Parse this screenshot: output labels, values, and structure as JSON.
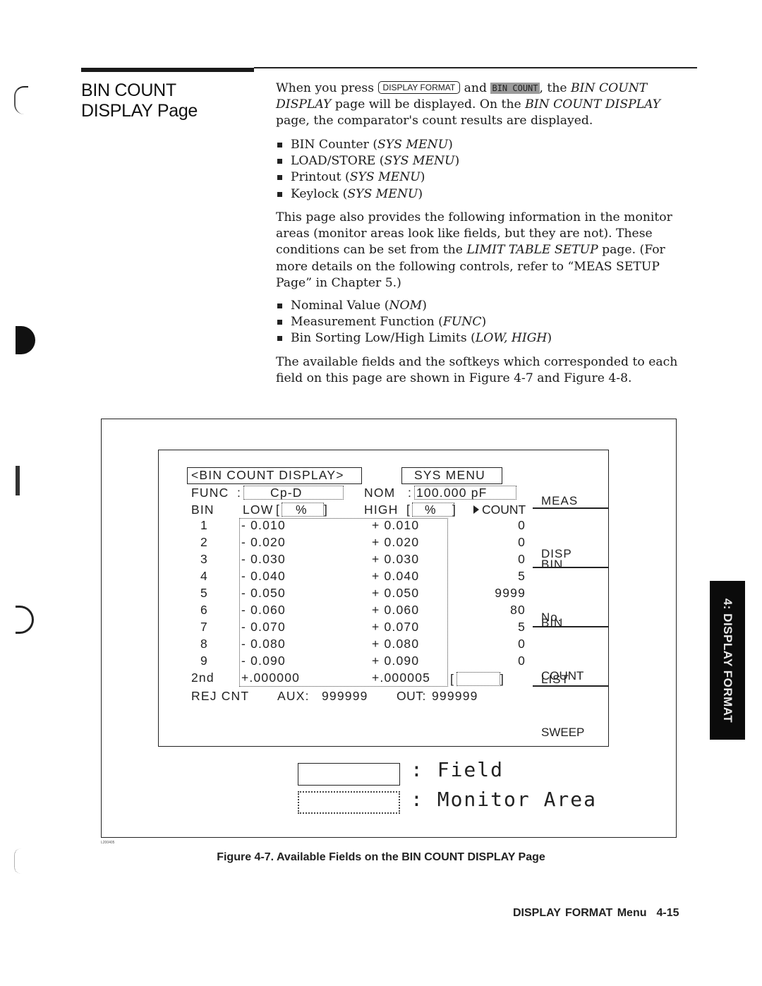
{
  "section": {
    "title_line1": "BIN COUNT",
    "title_line2": "DISPLAY Page"
  },
  "intro": {
    "text_before_key": "When you press ",
    "hardkey": "DISPLAY FORMAT",
    "text_and": " and ",
    "softkey": "BIN COUNT",
    "text_the": ", the ",
    "page_name_1": "BIN COUNT DISPLAY",
    "text_mid": " page will be displayed. On the ",
    "page_name_2": "BIN COUNT DISPLAY",
    "text_end": " page, the comparator's count results are displayed."
  },
  "bullets_fields": [
    {
      "label": "BIN Counter",
      "menu": "SYS MENU"
    },
    {
      "label": "LOAD/STORE",
      "menu": "SYS MENU"
    },
    {
      "label": "Printout",
      "menu": "SYS MENU"
    },
    {
      "label": "Keylock",
      "menu": "SYS MENU"
    }
  ],
  "para2": {
    "text_a": "This page also provides the following information in the monitor areas (monitor areas look like fields, but they are not). These conditions can be set from the ",
    "page_ref": "LIMIT TABLE SETUP",
    "text_b": " page. (For more details on the following controls, refer to “MEAS SETUP Page” in Chapter 5.)"
  },
  "bullets_monitors": [
    {
      "label": "Nominal Value",
      "abbr": "NOM"
    },
    {
      "label": "Measurement Function",
      "abbr": "FUNC"
    },
    {
      "label": "Bin Sorting Low/High Limits",
      "abbr": "LOW, HIGH"
    }
  ],
  "para3": "The available fields and the softkeys which corresponded to each field on this page are shown in Figure 4-7 and Figure 4-8.",
  "lcd": {
    "page_field": "<BIN COUNT DISPLAY>",
    "sys_menu_field": "SYS MENU",
    "func_label": "FUNC",
    "func_value": "Cp-D",
    "nom_label": "NOM",
    "nom_value": "100.000 pF",
    "bin_header": "BIN",
    "low_header": "LOW",
    "high_header": "HIGH",
    "unit": "%",
    "count_header": "COUNT",
    "rows": [
      {
        "bin": "1",
        "low": "- 0.010",
        "high": "+ 0.010",
        "count": "0"
      },
      {
        "bin": "2",
        "low": "- 0.020",
        "high": "+ 0.020",
        "count": "0"
      },
      {
        "bin": "3",
        "low": "- 0.030",
        "high": "+ 0.030",
        "count": "0"
      },
      {
        "bin": "4",
        "low": "- 0.040",
        "high": "+ 0.040",
        "count": "5"
      },
      {
        "bin": "5",
        "low": "- 0.050",
        "high": "+ 0.050",
        "count": "9999"
      },
      {
        "bin": "6",
        "low": "- 0.060",
        "high": "+ 0.060",
        "count": "80"
      },
      {
        "bin": "7",
        "low": "- 0.070",
        "high": "+ 0.070",
        "count": "5"
      },
      {
        "bin": "8",
        "low": "- 0.080",
        "high": "+ 0.080",
        "count": "0"
      },
      {
        "bin": "9",
        "low": "- 0.090",
        "high": "+ 0.090",
        "count": "0"
      },
      {
        "bin": "2nd",
        "low": "+.000000",
        "high": "+.000005",
        "count": ""
      }
    ],
    "rej_label": "REJ CNT",
    "aux_label": "AUX:",
    "aux_value": "999999",
    "out_label": "OUT:",
    "out_value": "999999",
    "softkeys": [
      {
        "line1": "MEAS",
        "line2": "DISP"
      },
      {
        "line1": "BIN",
        "line2": "No."
      },
      {
        "line1": "BIN",
        "line2": "COUNT"
      },
      {
        "line1": "LIST",
        "line2": "SWEEP"
      },
      {
        "line1": "",
        "line2": ""
      }
    ]
  },
  "legend": {
    "field_label": ": Field",
    "monitor_label": ": Monitor Area"
  },
  "figure_id": "L200405",
  "caption": "Figure 4-7. Available Fields on the BIN COUNT DISPLAY Page",
  "footer": {
    "chapter": "DISPLAY FORMAT Menu",
    "page": "4-15"
  },
  "thumb_tab": "4: DISPLAY FORMAT"
}
